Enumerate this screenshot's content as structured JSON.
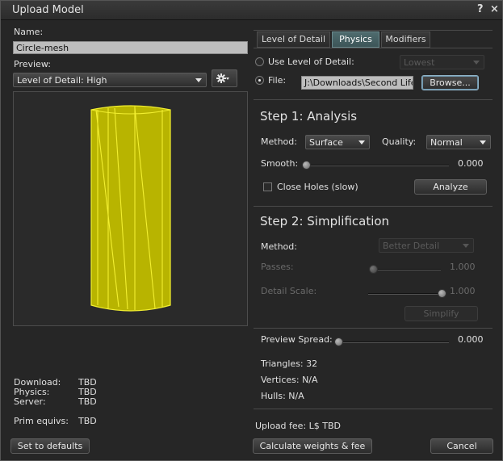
{
  "window": {
    "title": "Upload Model",
    "help_glyph": "?",
    "close_glyph": "×"
  },
  "left": {
    "name_label": "Name:",
    "name_value": "Circle-mesh",
    "preview_label": "Preview:",
    "preview_select": "Level of Detail: High",
    "gear_icon": "gear-icon",
    "stats": [
      {
        "label": "Download:",
        "value": "TBD"
      },
      {
        "label": "Physics:",
        "value": "TBD"
      },
      {
        "label": "Server:",
        "value": "TBD"
      }
    ],
    "prim_label": "Prim equivs:",
    "prim_value": "TBD",
    "set_defaults": "Set to defaults"
  },
  "tabs": [
    {
      "label": "Level of Detail"
    },
    {
      "label": "Physics"
    },
    {
      "label": "Modifiers"
    }
  ],
  "physics": {
    "use_lod_label": "Use Level of Detail:",
    "use_lod_select": "Lowest",
    "file_label": "File:",
    "file_value": "J:\\Downloads\\Second Life",
    "browse": "Browse...",
    "step1": {
      "heading": "Step 1: Analysis",
      "method_label": "Method:",
      "method_value": "Surface",
      "quality_label": "Quality:",
      "quality_value": "Normal",
      "smooth_label": "Smooth:",
      "smooth_value": "0.000",
      "smooth_level": 0,
      "close_holes": "Close Holes (slow)",
      "analyze": "Analyze"
    },
    "step2": {
      "heading": "Step 2: Simplification",
      "method_label": "Method:",
      "method_value": "Better Detail",
      "passes_label": "Passes:",
      "passes_value": "1.000",
      "passes_level": 0,
      "detail_label": "Detail Scale:",
      "detail_value": "1.000",
      "detail_level": 1,
      "simplify": "Simplify"
    },
    "preview_spread_label": "Preview Spread:",
    "preview_spread_value": "0.000",
    "preview_spread_level": 0,
    "triangles": "Triangles: 32",
    "vertices": "Vertices: N/A",
    "hulls": "Hulls: N/A"
  },
  "footer": {
    "upload_fee": "Upload fee: L$ TBD",
    "calculate": "Calculate weights & fee",
    "cancel": "Cancel"
  },
  "colors": {
    "mesh_fill": "#b8b400",
    "mesh_wire": "#f2ef30",
    "active_tab": "#4f6b6e"
  }
}
